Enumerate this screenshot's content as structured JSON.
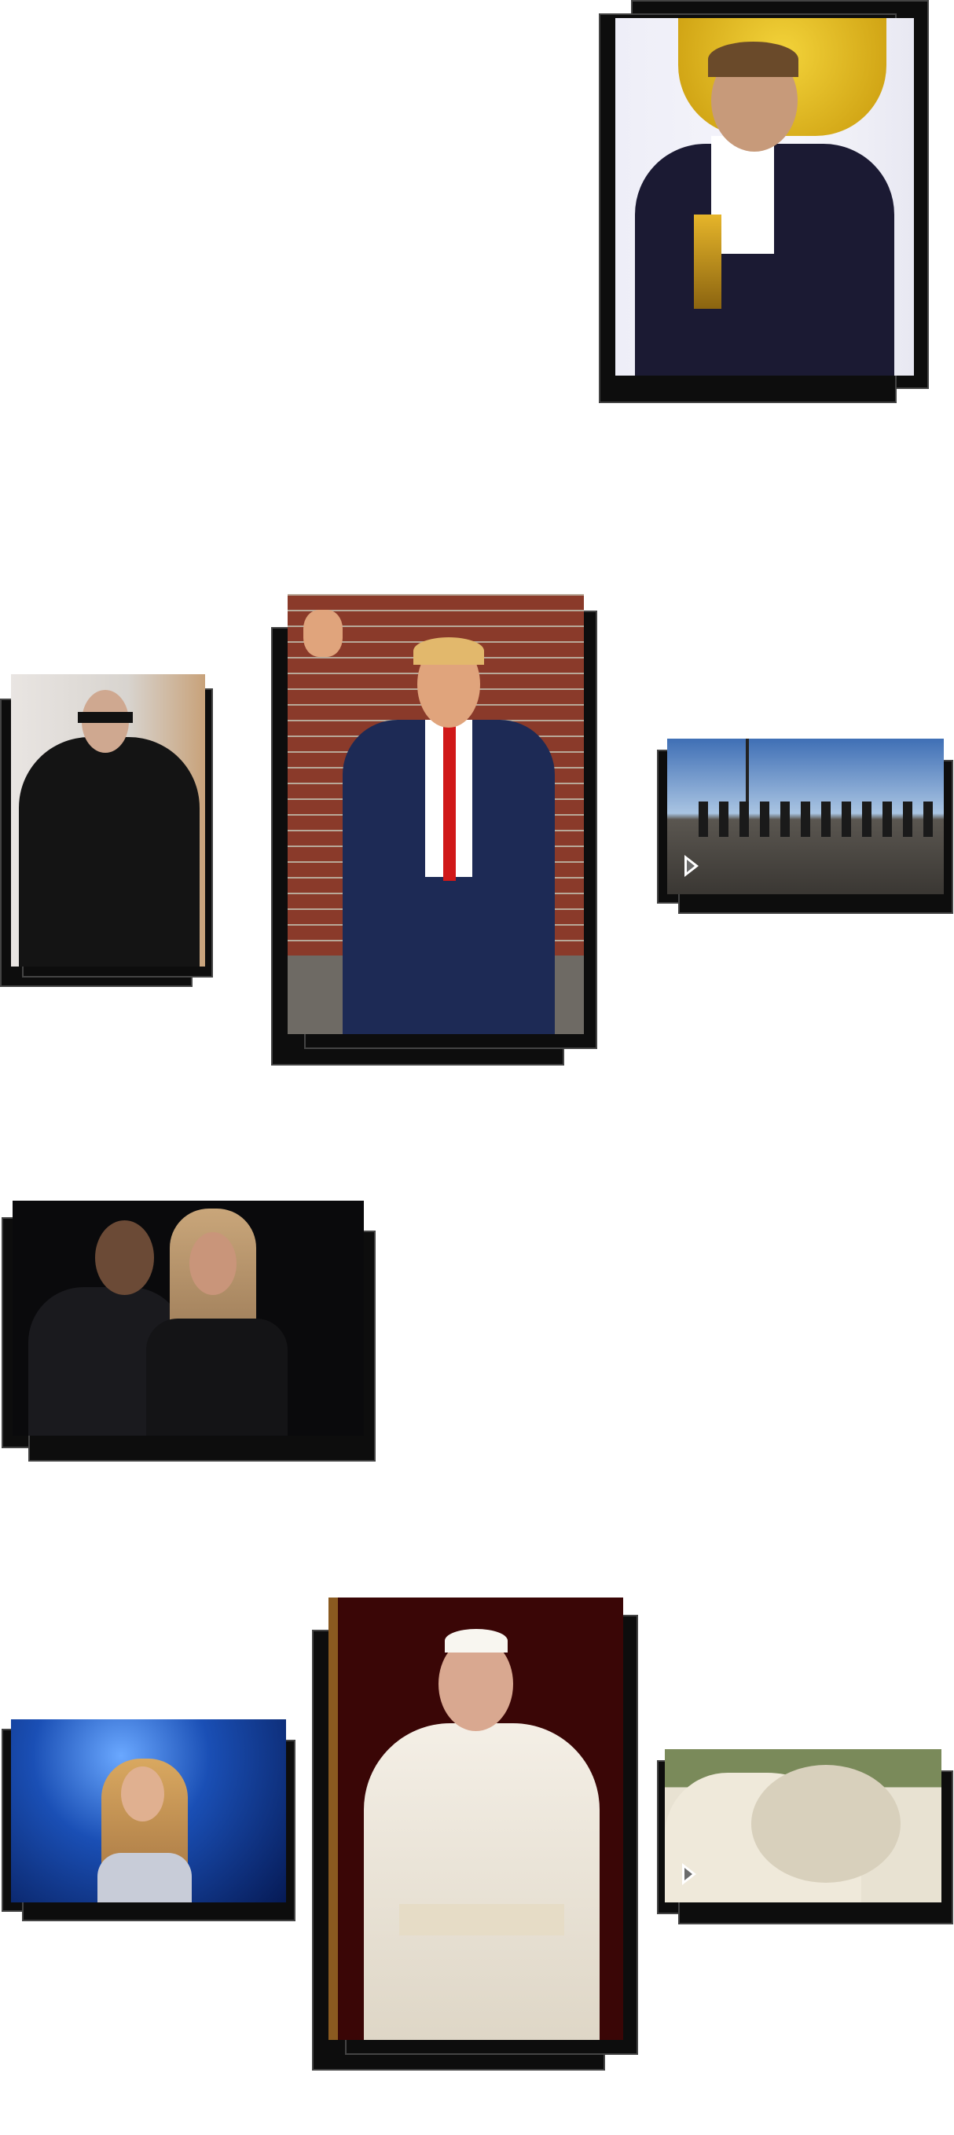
{
  "gallery": {
    "items": [
      {
        "id": "oscar-winner",
        "kind": "photo"
      },
      {
        "id": "woman-in-black-coat",
        "kind": "photo"
      },
      {
        "id": "man-waving",
        "kind": "photo"
      },
      {
        "id": "people-walking",
        "kind": "video",
        "icon": "play-icon"
      },
      {
        "id": "couple-at-night",
        "kind": "photo"
      },
      {
        "id": "singer-on-stage",
        "kind": "photo"
      },
      {
        "id": "pope-covering-face",
        "kind": "photo"
      },
      {
        "id": "polar-bears",
        "kind": "video",
        "icon": "play-icon"
      }
    ]
  },
  "colors": {
    "frame": "#0d0d0d",
    "frame_border": "#444444",
    "background": "#ffffff"
  }
}
